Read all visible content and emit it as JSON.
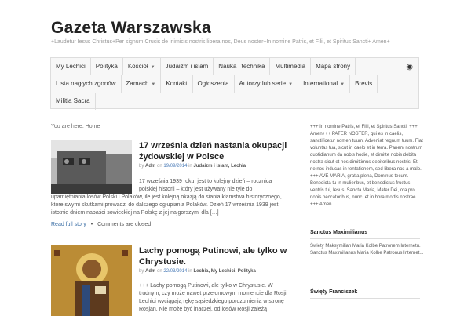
{
  "header": {
    "title": "Gazeta Warszawska",
    "description": "+Laudetur Iesus Christus+Per signum Crucis de inimicis nostris libera nos, Deus noster+In nomine Patris, et Filii, et Spiritus Sancti+ Amen+"
  },
  "nav": {
    "row1": [
      {
        "label": "My Lechici",
        "caret": false
      },
      {
        "label": "Polityka",
        "caret": false
      },
      {
        "label": "Kościół",
        "caret": true
      },
      {
        "label": "Judaizm i islam",
        "caret": false
      },
      {
        "label": "Nauka i technika",
        "caret": false
      },
      {
        "label": "Multimedia",
        "caret": false
      },
      {
        "label": "Mapa strony",
        "caret": false
      }
    ],
    "row2": [
      {
        "label": "Lista nagłych zgonów",
        "caret": false
      },
      {
        "label": "Zamach",
        "caret": true
      },
      {
        "label": "Kontakt",
        "caret": false
      },
      {
        "label": "Ogłoszenia",
        "caret": false
      },
      {
        "label": "Autorzy lub serie",
        "caret": true
      },
      {
        "label": "International",
        "caret": true
      },
      {
        "label": "Brevis",
        "caret": false
      }
    ],
    "row3": [
      {
        "label": "Militia Sacra",
        "caret": false
      }
    ],
    "caret_glyph": "▼",
    "rss_icon": "rss-icon",
    "rss_glyph": "◉"
  },
  "breadcrumb": "You are here: Home",
  "posts": [
    {
      "title": "17 września dzień nastania okupacji żydowskiej w Polsce",
      "by": "by",
      "author": "Adm",
      "on": "on",
      "date": "19/09/2014",
      "in": "in",
      "categories": "Judaizm i islam, Lechia",
      "excerpt_short": "17 września 1939 roku, jest to kolejny dzień – rocznica polskiej historii – który jest używany nie tyle do",
      "excerpt_long": "upamiętniania losów Polski i Polaków, ile jest kolejną okazją do siania kłamstwa historycznego, które swymi skutkami prowadzi do dalszego ogłupiania Polaków. Dzień 17 września 1939 jest istotnie dniem napaści sowieckiej na Polskę z jej najgorszymi dla […]",
      "read_more": "Read full story",
      "separator": "•",
      "comments": "Comments are closed"
    },
    {
      "title": "Lachy pomogą Putinowi, ale tylko w Chrystusie.",
      "by": "by",
      "author": "Adm",
      "on": "on",
      "date": "22/03/2014",
      "in": "in",
      "categories": "Lechia, My Lechici, Polityka",
      "excerpt_short": "+++ Lachy pomogą Putinowi, ale tylko w Chrystusie.    W trudnym, czy może nawet przełomowym momencie dla Rosji, Lechici wyciągają rękę sąsiedzkiego porozumienia w stronę Rosjan. Nie może być inaczej, od losów Rosji zależą"
    }
  ],
  "sidebar": {
    "prayer": "+++ In nomine Patris, et Filii, et Spiritus Sancti. +++ Amen+++ PATER NOSTER, qui es in caelis, sanctificetur nomen tuum. Adveniat regnum tuum. Fiat voluntas tua, sicut in caelo et in terra. Panem nostrum quotidianum da nobis hodie, et dimitte nobis debita nostra sicut et nos dimittimus debitoribus nostris. Et ne nos inducas in tentationem, sed libera nos a malo. +++ AVE MARIA, gratia plena, Dominus tecum. Benedicta tu in mulieribus, et benedictus fructus ventris tui, Iesus. Sancta Maria, Mater Dei, ora pro nobis peccatoribus, nunc, et in hora mortis nostrae. +++ Amen.",
    "widget1_title": "Sanctus Maximilianus",
    "widget1_text": "Święty Maksymilian Maria Kolbe Patronem Internetu. Sanctus Maximilianus Maria Kolbe Patronus Internet...",
    "widget2_title": "Święty Franciszek"
  }
}
